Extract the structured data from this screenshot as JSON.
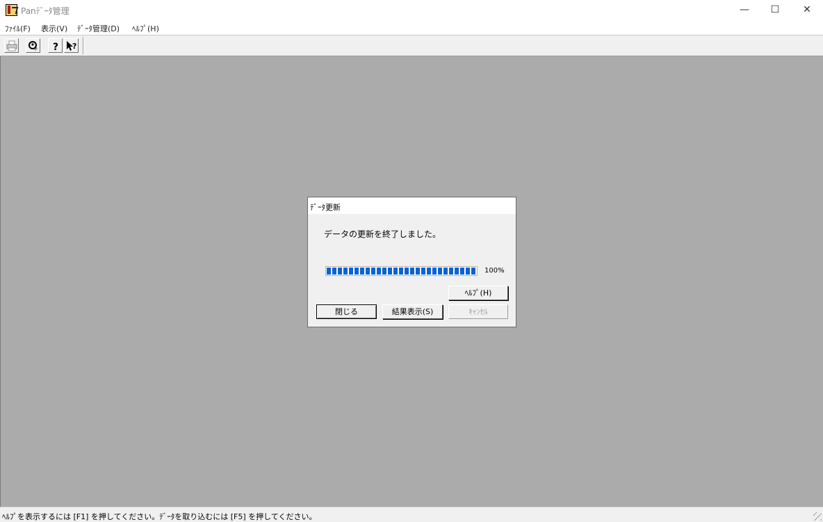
{
  "window": {
    "title": "Panﾃﾞｰﾀ管理",
    "minimize": "—",
    "maximize": "☐",
    "close": "✕"
  },
  "menu": [
    "ﾌｧｲﾙ(F)",
    "表示(V)",
    "ﾃﾞｰﾀ管理(D)",
    "ﾍﾙﾌﾟ(H)"
  ],
  "toolbar": {
    "icons": [
      "printer-icon",
      "user-settings-icon",
      "help-icon",
      "context-help-icon"
    ]
  },
  "dialog": {
    "title": "ﾃﾞｰﾀ更新",
    "message": "データの更新を終了しました。",
    "progress": {
      "value": 100,
      "label": "100%",
      "color": "#0a64d0"
    },
    "help_button": "ﾍﾙﾌﾟ(H)",
    "close_button": "閉じる",
    "result_button": "結果表示(S)",
    "cancel_button": "ｷｬﾝｾﾙ"
  },
  "status": {
    "text": "ﾍﾙﾌﾟを表示するには [F1] を押してください。ﾃﾞｰﾀを取り込むには [F5] を押してください。"
  }
}
